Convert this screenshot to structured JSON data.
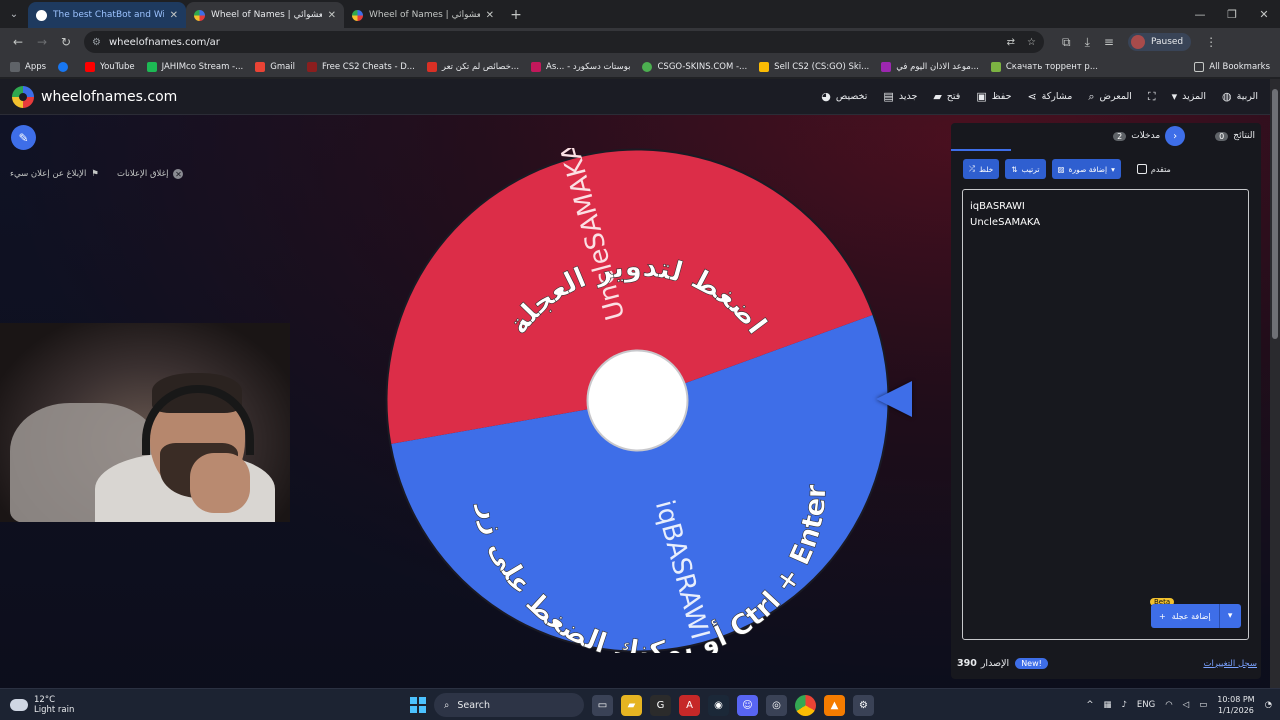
{
  "browser": {
    "tabs": [
      {
        "title": "The best ChatBot and Widgets",
        "favicon_color": "#ffffff",
        "state": "first"
      },
      {
        "title": "Wheel of Names | اسم العشوائي",
        "favicon_color": "#e8453c",
        "state": "active"
      },
      {
        "title": "Wheel of Names | اسم العشوائي",
        "favicon_color": "#e8453c",
        "state": "inactive"
      }
    ],
    "url": "wheelofnames.com/ar",
    "profile_label": "Paused",
    "bookmarks": [
      {
        "label": "Apps",
        "color": "#5f6368"
      },
      {
        "label": "",
        "color": "#1877f2"
      },
      {
        "label": "YouTube",
        "color": "#ff0000"
      },
      {
        "label": "JAHIMco Stream -...",
        "color": "#1db954"
      },
      {
        "label": "Gmail",
        "color": "#ea4335"
      },
      {
        "label": "Free CS2 Cheats - D...",
        "color": "#8b1e1e"
      },
      {
        "label": "خصائص لم تكن تعر...",
        "color": "#d93025"
      },
      {
        "label": "As... - بوستات دسكورد",
        "color": "#c2185b"
      },
      {
        "label": "CSGO-SKINS.COM -...",
        "color": "#4caf50"
      },
      {
        "label": "Sell CS2 (CS:GO) Ski...",
        "color": "#fbbc04"
      },
      {
        "label": "موعد الاذان اليوم في...",
        "color": "#9c27b0"
      },
      {
        "label": "Скачать торрент р...",
        "color": "#7cb342"
      }
    ],
    "all_bookmarks": "All Bookmarks"
  },
  "app": {
    "brand": "wheelofnames.com",
    "menu": [
      {
        "label": "الربية",
        "icon": "globe-icon"
      },
      {
        "label": "المزيد",
        "icon": "chevron-down-icon"
      },
      {
        "label": "",
        "icon": "fullscreen-icon"
      },
      {
        "label": "المعرض",
        "icon": "search-icon"
      },
      {
        "label": "مشاركة",
        "icon": "share-icon"
      },
      {
        "label": "حفظ",
        "icon": "save-icon"
      },
      {
        "label": "فتح",
        "icon": "folder-icon"
      },
      {
        "label": "جديد",
        "icon": "file-icon"
      },
      {
        "label": "تخصيص",
        "icon": "palette-icon"
      }
    ],
    "ad_links": [
      "الإبلاغ عن إعلان سيء",
      "إغلاق الإعلانات"
    ]
  },
  "wheel": {
    "segments": [
      {
        "label": "iqBASRAWI",
        "color": "#3e6ee8",
        "start_deg": 340,
        "end_deg": 170
      },
      {
        "label": "UncleSAMAKA",
        "color": "#dc2d48",
        "start_deg": 170,
        "end_deg": 340
      }
    ],
    "overlay_top": "اضغط لتدوير العجلة",
    "overlay_bottom": "أو يمكنك الضغط على زر Ctrl + Enter"
  },
  "panel": {
    "tabs": [
      {
        "label": "مدخلات",
        "count": "2"
      },
      {
        "label": "النتائج",
        "count": "0"
      }
    ],
    "actions": {
      "shuffle": "خلط",
      "sort": "ترتيب",
      "add_image": "إضافة صورة",
      "advanced": "متقدم"
    },
    "entries": [
      "iqBASRAWI",
      "UncleSAMAKA"
    ],
    "add_wheel": "إضافة عجلة",
    "beta": "Beta",
    "version_label": "الإصدار",
    "version": "390",
    "new_badge": "New!",
    "changelog": "سجل التغييرات"
  },
  "taskbar": {
    "temp": "12°C",
    "weather": "Light rain",
    "search": "Search",
    "lang": "ENG",
    "time": "10:08 PM",
    "date": "1/1/2026"
  }
}
